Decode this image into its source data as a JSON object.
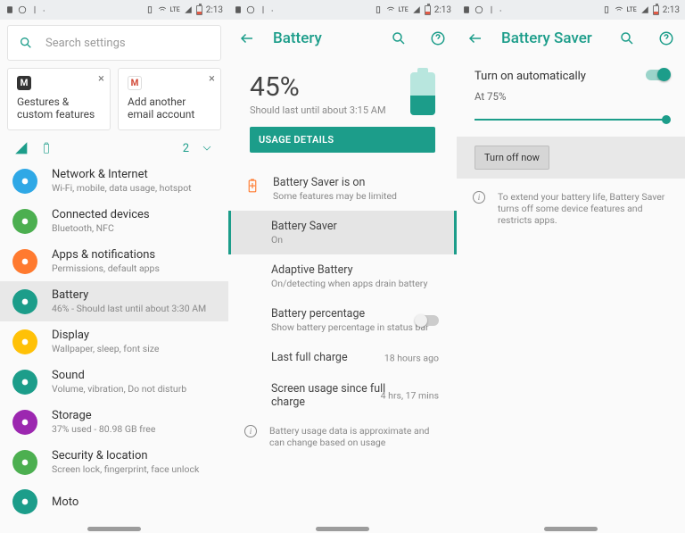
{
  "statusbar": {
    "lte": "LTE",
    "time": "2:13"
  },
  "screen1": {
    "search_placeholder": "Search settings",
    "suggestions": [
      {
        "icon": "M",
        "label": "Gestures & custom features"
      },
      {
        "icon": "M",
        "label": "Add another email account"
      }
    ],
    "cond_badge": "2",
    "items": [
      {
        "color": "#2fa8e6",
        "title": "Network & Internet",
        "sub": "Wi-Fi, mobile, data usage, hotspot"
      },
      {
        "color": "#4caf50",
        "title": "Connected devices",
        "sub": "Bluetooth, NFC"
      },
      {
        "color": "#ff7a2f",
        "title": "Apps & notifications",
        "sub": "Permissions, default apps"
      },
      {
        "color": "#1c9d8a",
        "title": "Battery",
        "sub": "46% - Should last until about 3:30 AM"
      },
      {
        "color": "#ffc107",
        "title": "Display",
        "sub": "Wallpaper, sleep, font size"
      },
      {
        "color": "#1c9d8a",
        "title": "Sound",
        "sub": "Volume, vibration, Do not disturb"
      },
      {
        "color": "#9c27b0",
        "title": "Storage",
        "sub": "37% used - 80.98 GB free"
      },
      {
        "color": "#4caf50",
        "title": "Security & location",
        "sub": "Screen lock, fingerprint, face unlock"
      },
      {
        "color": "#1c9d8a",
        "title": "Moto",
        "sub": ""
      }
    ]
  },
  "screen2": {
    "appbar_title": "Battery",
    "pct": "45%",
    "est": "Should last until about 3:15 AM",
    "usage_btn": "USAGE DETAILS",
    "notice_title": "Battery Saver is on",
    "notice_sub": "Some features may be limited",
    "rows": [
      {
        "title": "Battery Saver",
        "sub": "On"
      },
      {
        "title": "Adaptive Battery",
        "sub": "On/detecting when apps drain battery"
      },
      {
        "title": "Battery percentage",
        "sub": "Show battery percentage in status bar"
      },
      {
        "title": "Last full charge",
        "val": "18 hours ago"
      },
      {
        "title": "Screen usage since full charge",
        "val": "4 hrs, 17 mins"
      }
    ],
    "footer": "Battery usage data is approximate and can change based on usage"
  },
  "screen3": {
    "appbar_title": "Battery Saver",
    "auto_label": "Turn on automatically",
    "auto_value": "At 75%",
    "turnoff": "Turn off now",
    "info": "To extend your battery life, Battery Saver turns off some device features and restricts apps."
  }
}
